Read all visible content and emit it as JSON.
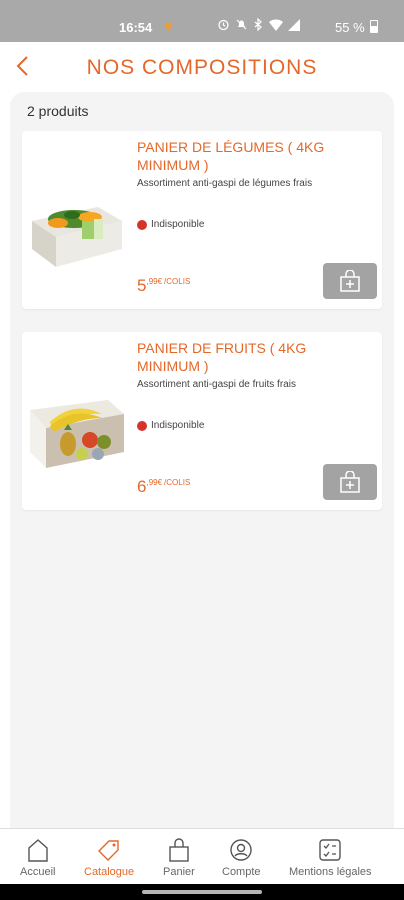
{
  "status_bar": {
    "time": "16:54",
    "battery": "55 %"
  },
  "header": {
    "title": "NOS COMPOSITIONS"
  },
  "catalog": {
    "count_label": "2 produits",
    "products": [
      {
        "title": "PANIER DE LÉGUMES ( 4KG MINIMUM )",
        "description": "Assortiment anti-gaspi de légumes frais",
        "availability": "Indisponible",
        "price_int": "5",
        "price_dec": ",99€",
        "unit": "/COLIS"
      },
      {
        "title": "PANIER DE FRUITS ( 4KG MINIMUM )",
        "description": "Assortiment anti-gaspi de fruits frais",
        "availability": "Indisponible",
        "price_int": "6",
        "price_dec": ",99€",
        "unit": "/COLIS"
      }
    ]
  },
  "bottom_nav": {
    "items": [
      {
        "label": "Accueil",
        "icon": "home-icon"
      },
      {
        "label": "Catalogue",
        "icon": "tag-icon",
        "active": true
      },
      {
        "label": "Panier",
        "icon": "bag-icon"
      },
      {
        "label": "Compte",
        "icon": "account-icon"
      },
      {
        "label": "Mentions légales",
        "icon": "checklist-icon"
      }
    ]
  },
  "colors": {
    "accent": "#e4682a",
    "unavailable": "#d6332b",
    "button_gray": "#a3a3a3"
  }
}
